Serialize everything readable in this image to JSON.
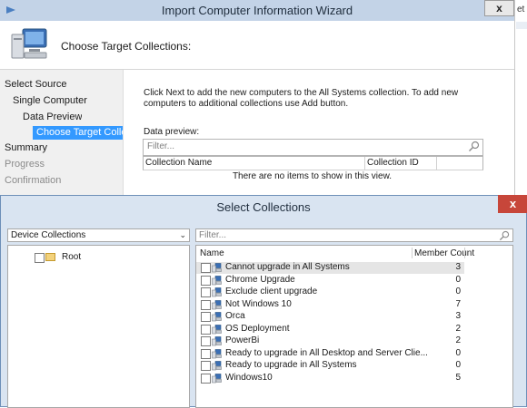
{
  "wizard": {
    "title": "Import Computer Information Wizard",
    "heading": "Choose Target Collections:",
    "close_label": "x",
    "nav": [
      {
        "label": "Select Source",
        "state": "normal"
      },
      {
        "label": "Single Computer",
        "state": "normal"
      },
      {
        "label": "Data Preview",
        "state": "normal"
      },
      {
        "label": "Choose Target Collect",
        "state": "selected"
      },
      {
        "label": "Summary",
        "state": "normal"
      },
      {
        "label": "Progress",
        "state": "dim"
      },
      {
        "label": "Confirmation",
        "state": "dim"
      }
    ],
    "instructions": "Click Next to add the new computers to the All Systems collection. To add new computers to additional collections use Add button.",
    "preview_label": "Data preview:",
    "filter_placeholder": "Filter...",
    "columns": [
      "Collection Name",
      "Collection ID"
    ],
    "empty_message": "There are no items to show in this view.",
    "right_edge_text": "et"
  },
  "dialog": {
    "title": "Select Collections",
    "close_label": "x",
    "collection_type": "Device Collections",
    "tree_root": "Root",
    "filter_placeholder": "Filter...",
    "columns": {
      "name": "Name",
      "count": "Member Count"
    },
    "collections": [
      {
        "name": "Cannot upgrade in All Systems",
        "count": "3",
        "selected": true
      },
      {
        "name": "Chrome Upgrade",
        "count": "0"
      },
      {
        "name": "Exclude client upgrade",
        "count": "0"
      },
      {
        "name": "Not Windows 10",
        "count": "7"
      },
      {
        "name": "Orca",
        "count": "3"
      },
      {
        "name": "OS Deployment",
        "count": "2"
      },
      {
        "name": "PowerBi",
        "count": "2"
      },
      {
        "name": "Ready to upgrade in All Desktop and Server Clie...",
        "count": "0"
      },
      {
        "name": "Ready to upgrade in All Systems",
        "count": "0"
      },
      {
        "name": "Windows10",
        "count": "5"
      }
    ]
  },
  "colors": {
    "title_bar": "#c3d3e7",
    "nav_selected": "#3399ff",
    "dialog_close": "#c7463a"
  }
}
